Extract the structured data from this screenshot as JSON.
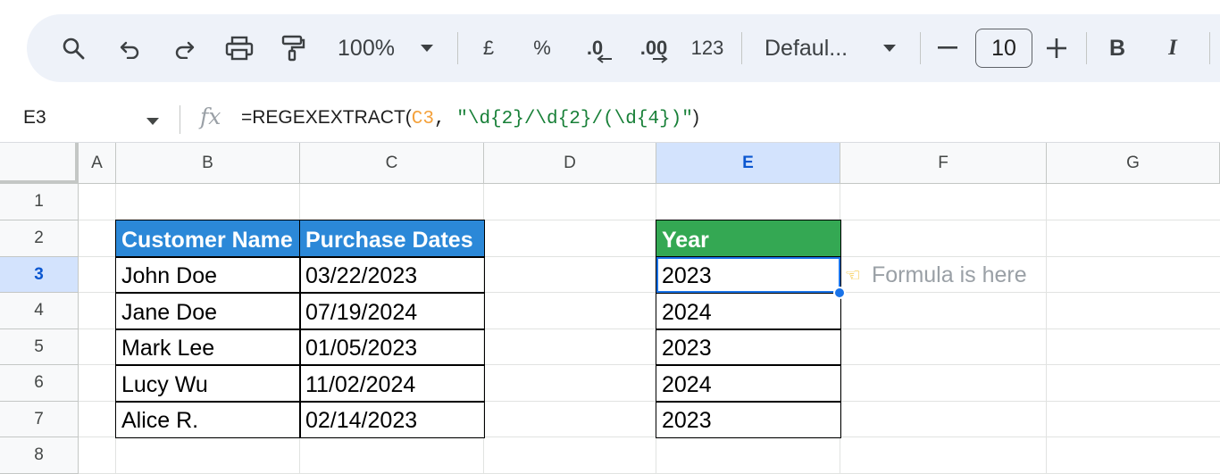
{
  "toolbar": {
    "zoom": "100%",
    "currency": "£",
    "percent": "%",
    "decrease_decimal": ".0",
    "increase_decimal": ".00",
    "number_format": "123",
    "font_name": "Defaul...",
    "font_size": "10",
    "bold": "B",
    "italic": "I",
    "icons": [
      "search-icon",
      "undo-icon",
      "redo-icon",
      "print-icon",
      "paint-format-icon",
      "dropdown-icon",
      "decrease-font-icon",
      "increase-font-icon"
    ]
  },
  "formula_bar": {
    "cell_ref": "E3",
    "fx": "fx",
    "formula_prefix": "=REGEXEXTRACT(",
    "formula_ref": "C3",
    "formula_sep": ", ",
    "formula_string": "\"\\d{2}/\\d{2}/(\\d{4})\"",
    "formula_suffix": ")"
  },
  "grid": {
    "columns": [
      "A",
      "B",
      "C",
      "D",
      "E",
      "F",
      "G"
    ],
    "rows": [
      "1",
      "2",
      "3",
      "4",
      "5",
      "6",
      "7",
      "8"
    ],
    "selected_column": "E",
    "selected_row": "3"
  },
  "table1": {
    "headers": [
      "Customer Name",
      "Purchase Dates"
    ],
    "rows": [
      [
        "John Doe",
        "03/22/2023"
      ],
      [
        "Jane Doe",
        "07/19/2024"
      ],
      [
        "Mark Lee",
        "01/05/2023"
      ],
      [
        "Lucy Wu",
        "11/02/2024"
      ],
      [
        "Alice R.",
        "02/14/2023"
      ]
    ],
    "header_color": "#2b88d8"
  },
  "table2": {
    "header": "Year",
    "values": [
      "2023",
      "2024",
      "2023",
      "2024",
      "2023"
    ],
    "header_color": "#34a853"
  },
  "note": {
    "icon": "pointing-hand-icon",
    "text": "Formula is here"
  },
  "colors": {
    "accent": "#1a73e8",
    "selected_header_bg": "#d3e3fd",
    "toolbar_bg": "#eef2f9"
  }
}
